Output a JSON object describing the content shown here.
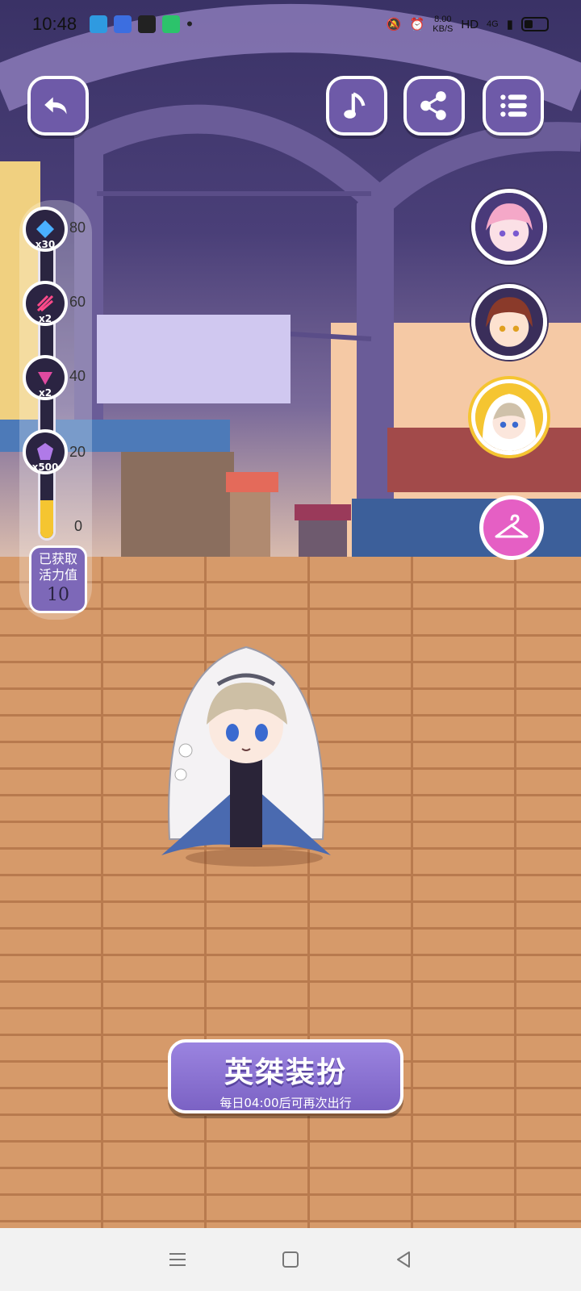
{
  "status_bar": {
    "time": "10:48",
    "network_speed": "8.00\nKB/S",
    "hd_label": "HD",
    "signal_label": "4G"
  },
  "top_buttons": {
    "back_icon": "back-arrow-icon",
    "music_icon": "music-note-icon",
    "share_icon": "share-icon",
    "menu_icon": "list-menu-icon"
  },
  "vitality": {
    "progress_fraction": 0.125,
    "current_value": "10",
    "label": "已获取\n活力值",
    "ticks": [
      "80",
      "60",
      "40",
      "20",
      "0"
    ],
    "milestones": [
      {
        "count": "x30",
        "icon": "blue-crystal-icon"
      },
      {
        "count": "x2",
        "icon": "red-shard-icon"
      },
      {
        "count": "x2",
        "icon": "pink-gem-icon"
      },
      {
        "count": "x500",
        "icon": "purple-crystal-icon"
      }
    ]
  },
  "portraits": [
    {
      "name": "pink-hair-character",
      "icon": "portrait-pink-hair"
    },
    {
      "name": "brown-hair-character",
      "icon": "portrait-brown-hair"
    },
    {
      "name": "veiled-character",
      "icon": "portrait-veiled",
      "selected": true
    }
  ],
  "wardrobe_icon": "hanger-icon",
  "dress_button": {
    "title": "英桀装扮",
    "subtitle": "每日04:00后可再次出行"
  },
  "colors": {
    "button_purple": "#7d68b8",
    "wardrobe_pink": "#e55fc4",
    "progress_yellow": "#f5c531"
  }
}
